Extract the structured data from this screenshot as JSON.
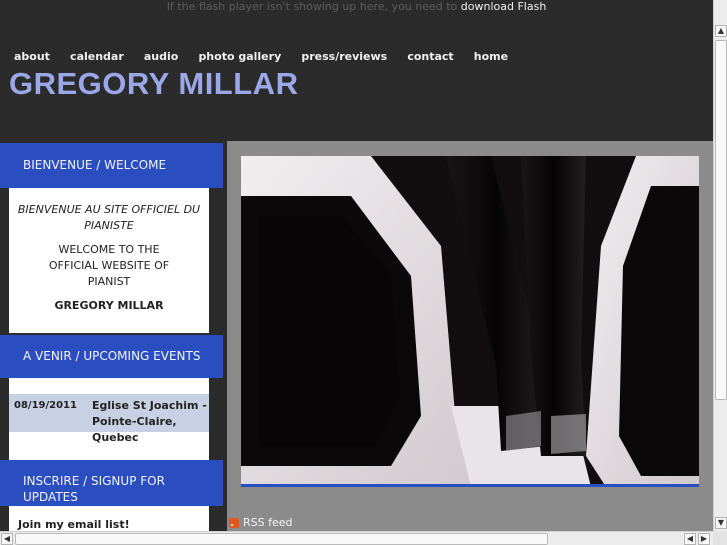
{
  "flash_notice": {
    "text": "If the flash player isn't showing up here, you need to",
    "link": "download Flash"
  },
  "nav": [
    "about",
    "calendar",
    "audio",
    "photo gallery",
    "press/reviews",
    "contact",
    "home"
  ],
  "site_title": "GREGORY MILLAR",
  "welcome": {
    "heading": "BIENVENUE / WELCOME",
    "french": "BIENVENUE AU SITE OFFICIEL DU PIANISTE",
    "english": "WELCOME TO THE OFFICIAL WEBSITE OF PIANIST",
    "name": "GREGORY MILLAR"
  },
  "events": {
    "heading": "A VENIR / UPCOMING EVENTS",
    "items": [
      {
        "date": "08/19/2011",
        "venue_line1": "Eglise St Joachim -",
        "venue_line2": "Pointe-Claire, Quebec"
      }
    ]
  },
  "signup": {
    "heading": "INSCRIRE / SIGNUP FOR UPDATES",
    "link": "Join my email list!"
  },
  "rss": {
    "label": "RSS feed",
    "icon": "rss-icon"
  },
  "colors": {
    "accent": "#2a4ec0",
    "title": "#9aa7e8",
    "background": "#2b2b2b",
    "content_bg": "#8b8b8b"
  }
}
